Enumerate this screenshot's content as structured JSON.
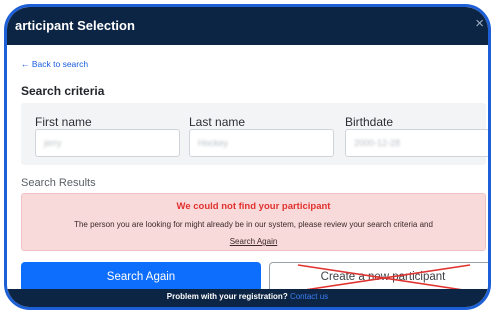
{
  "window": {
    "title": "articipant Selection",
    "close_glyph": "×"
  },
  "back_link": "← Back to search",
  "search_criteria": {
    "heading": "Search criteria",
    "fields": [
      {
        "label": "First name",
        "value": "jerry"
      },
      {
        "label": "Last name",
        "value": "Hockey"
      },
      {
        "label": "Birthdate",
        "value": "2000-12-28"
      }
    ]
  },
  "results": {
    "heading": "Search Results",
    "alert_title": "We could not find your participant",
    "alert_message": "The person you are looking for might already be in our system, please review your search criteria and",
    "alert_link": "Search Again"
  },
  "buttons": {
    "search_again": "Search Again",
    "create_new": "Create a new participant"
  },
  "footer": {
    "text": "Problem with your registration?",
    "link": "Contact us"
  },
  "colors": {
    "header": "#0c2544",
    "primary": "#0d6efd",
    "alert_bg": "#f9dada",
    "alert_title": "#e0322f",
    "strike": "#e0322f",
    "frame": "#1d5fd6"
  },
  "icons": {
    "close": "close-icon",
    "back": "arrow-left-icon",
    "strike": "strike-through-x-icon"
  }
}
